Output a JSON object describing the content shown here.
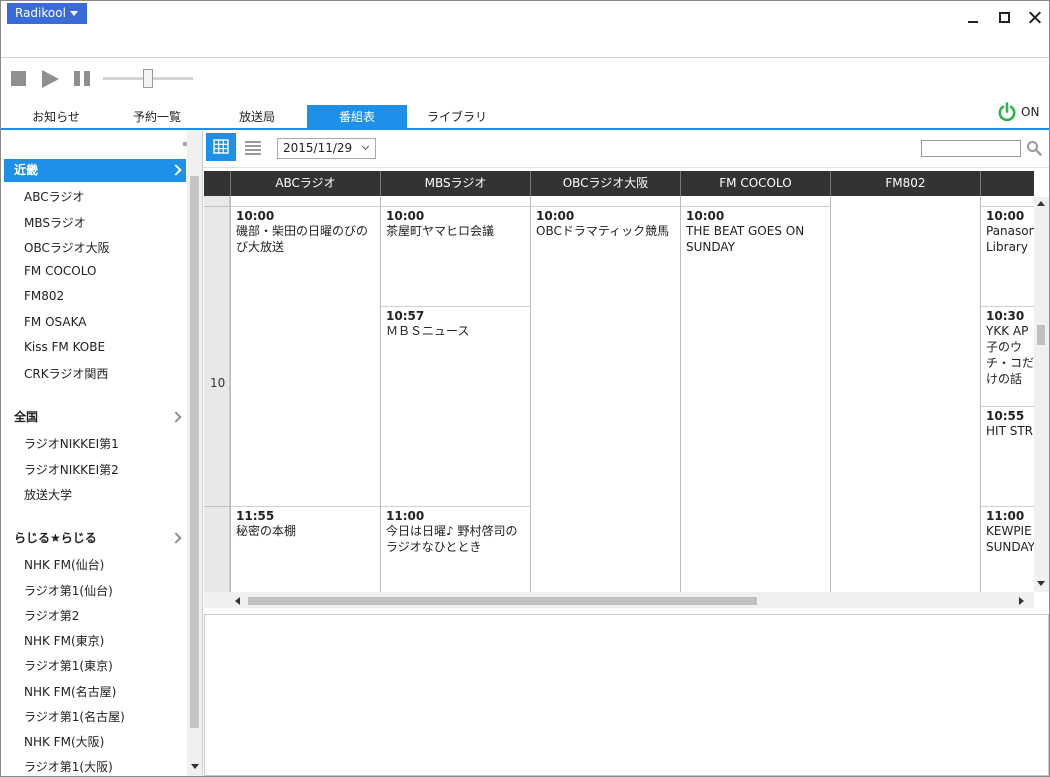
{
  "app": {
    "menu_label": "Radikool"
  },
  "tabs": [
    {
      "label": "お知らせ",
      "active": false
    },
    {
      "label": "予約一覧",
      "active": false
    },
    {
      "label": "放送局",
      "active": false
    },
    {
      "label": "番組表",
      "active": true
    },
    {
      "label": "ライブラリ",
      "active": false
    }
  ],
  "power": {
    "label": "ON",
    "color": "#2db34a"
  },
  "sidebar": {
    "groups": [
      {
        "label": "近畿",
        "active": true,
        "stations": [
          "ABCラジオ",
          "MBSラジオ",
          "OBCラジオ大阪",
          "FM COCOLO",
          "FM802",
          "FM OSAKA",
          "Kiss FM KOBE",
          "CRKラジオ関西"
        ]
      },
      {
        "label": "全国",
        "active": false,
        "stations": [
          "ラジオNIKKEI第1",
          "ラジオNIKKEI第2",
          "放送大学"
        ]
      },
      {
        "label": "らじる★らじる",
        "active": false,
        "stations": [
          "NHK FM(仙台)",
          "ラジオ第1(仙台)",
          "ラジオ第2",
          "NHK FM(東京)",
          "ラジオ第1(東京)",
          "NHK FM(名古屋)",
          "ラジオ第1(名古屋)",
          "NHK FM(大阪)",
          "ラジオ第1(大阪)"
        ]
      }
    ]
  },
  "toolbar": {
    "date": "2015/11/29",
    "search_placeholder": ""
  },
  "schedule": {
    "hour_label": "10",
    "columns": [
      "ABCラジオ",
      "MBSラジオ",
      "OBCラジオ大阪",
      "FM COCOLO",
      "FM802",
      "F"
    ],
    "programs": {
      "abc": [
        {
          "time": "10:00",
          "title": "磯部・柴田の日曜のびのび大放送"
        },
        {
          "time": "11:55",
          "title": "秘密の本棚"
        }
      ],
      "mbs": [
        {
          "time": "10:00",
          "title": "茶屋町ヤマヒロ会議"
        },
        {
          "time": "10:57",
          "title": "ＭＢＳニュース"
        },
        {
          "time": "11:00",
          "title": "今日は日曜♪ 野村啓司のラジオなひととき"
        }
      ],
      "obc": [
        {
          "time": "10:00",
          "title": "OBCドラマティック競馬"
        }
      ],
      "cocolo": [
        {
          "time": "10:00",
          "title": "THE BEAT GOES ON SUNDAY"
        }
      ],
      "fmo": [
        {
          "time": "10:00",
          "title": "Panasonic Library"
        },
        {
          "time": "10:30",
          "title": "YKK AP 子のウチ・コだけの話"
        },
        {
          "time": "10:55",
          "title": "HIT STR"
        },
        {
          "time": "11:00",
          "title": "KEWPIE SUNDAY"
        }
      ]
    }
  }
}
